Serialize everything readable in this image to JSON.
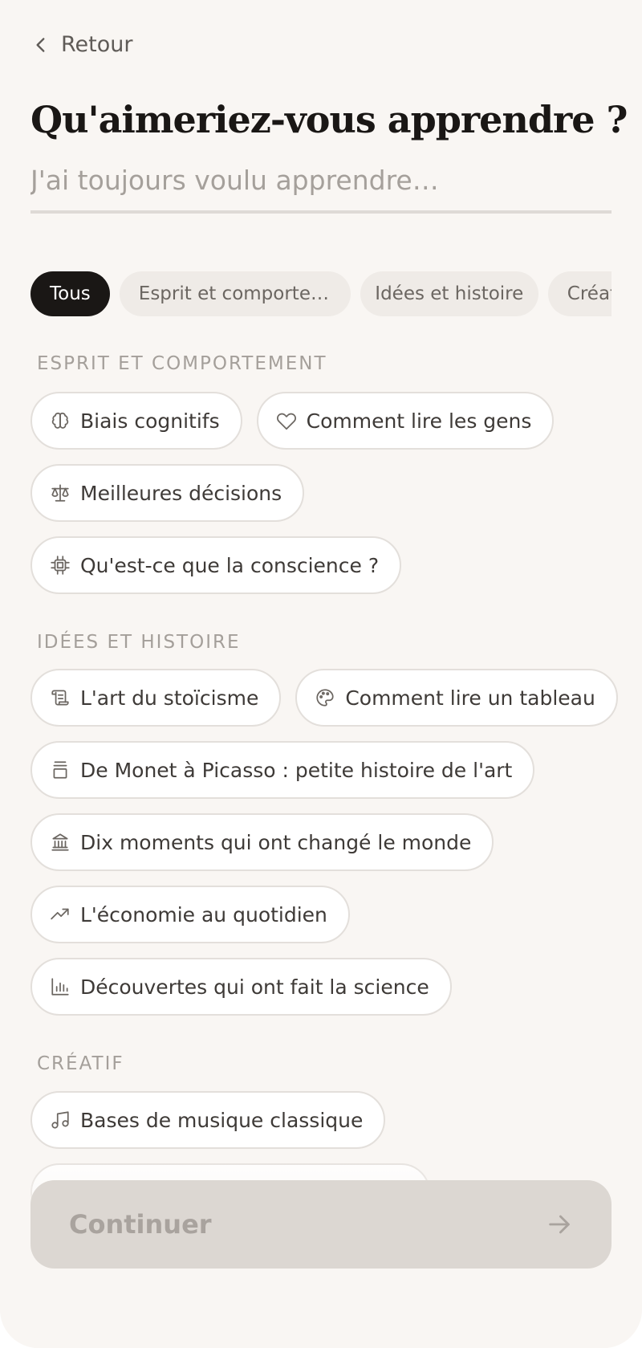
{
  "header": {
    "back_label": "Retour",
    "title": "Qu'aimeriez-vous apprendre ?"
  },
  "search": {
    "placeholder": "J'ai toujours voulu apprendre…",
    "value": ""
  },
  "filters": [
    {
      "label": "Tous",
      "active": true
    },
    {
      "label": "Esprit et comporte…",
      "active": false
    },
    {
      "label": "Idées et histoire",
      "active": false
    },
    {
      "label": "Créatif",
      "active": false
    }
  ],
  "sections": [
    {
      "title": "ESPRIT ET COMPORTEMENT",
      "topics": [
        {
          "label": "Biais cognitifs",
          "icon": "brain-icon"
        },
        {
          "label": "Comment lire les gens",
          "icon": "heart-icon"
        },
        {
          "label": "Meilleures décisions",
          "icon": "scale-icon"
        },
        {
          "label": "Qu'est-ce que la conscience ?",
          "icon": "chip-icon"
        }
      ]
    },
    {
      "title": "IDÉES ET HISTOIRE",
      "topics": [
        {
          "label": "L'art du stoïcisme",
          "icon": "scroll-icon"
        },
        {
          "label": "Comment lire un tableau",
          "icon": "palette-icon"
        },
        {
          "label": "De Monet à Picasso : petite histoire de l'art",
          "icon": "column-icon"
        },
        {
          "label": "Dix moments qui ont changé le monde",
          "icon": "landmark-icon"
        },
        {
          "label": "L'économie au quotidien",
          "icon": "trending-up-icon"
        },
        {
          "label": "Découvertes qui ont fait la science",
          "icon": "bar-chart-icon"
        }
      ]
    },
    {
      "title": "CRÉATIF",
      "topics": [
        {
          "label": "Bases de musique classique",
          "icon": "music-icon"
        }
      ]
    }
  ],
  "footer": {
    "continue_label": "Continuer"
  },
  "colors": {
    "background": "#f9f6f3",
    "accent": "#1a1715",
    "chip": "#efebe7",
    "button_disabled": "#dcd7d2"
  }
}
